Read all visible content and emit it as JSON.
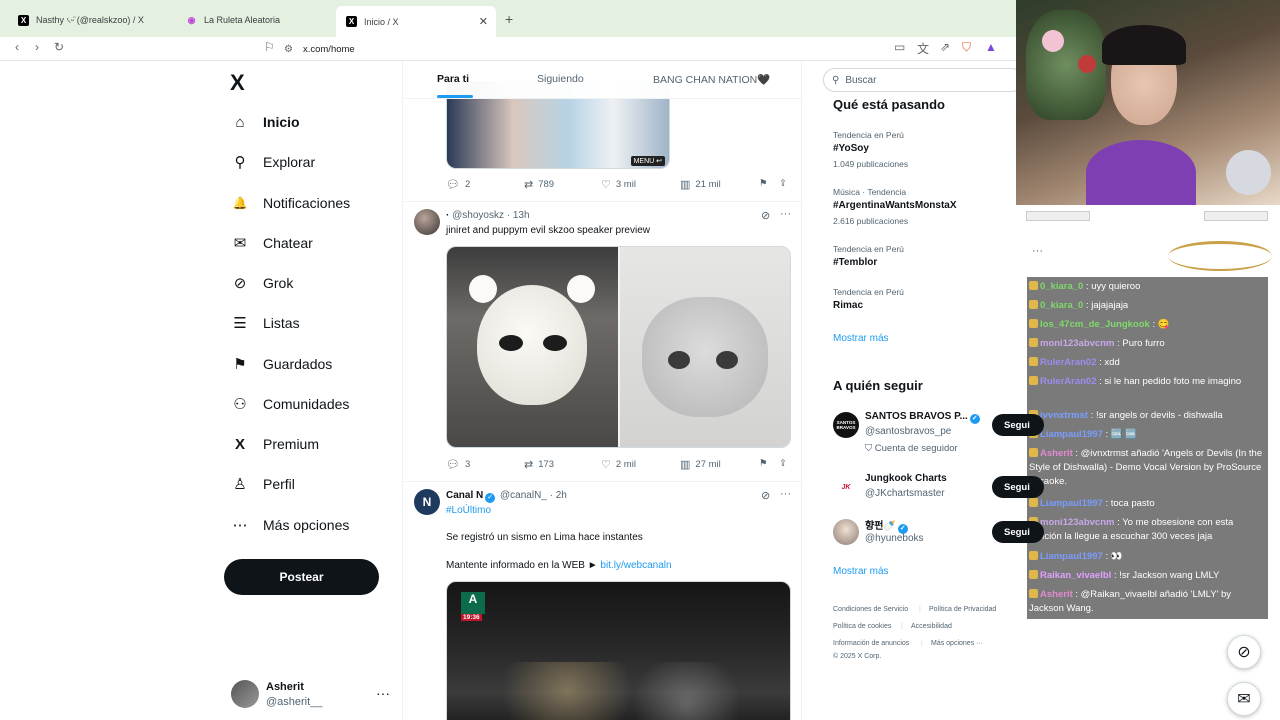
{
  "browser": {
    "tabs": [
      {
        "label": "Nasthy ৻ᵕ̈ (@realskzoo) / X",
        "favicon": "x-logo"
      },
      {
        "label": "La Ruleta Aleatoria",
        "favicon": "roulette"
      },
      {
        "label": "Inicio / X",
        "favicon": "x-logo"
      }
    ],
    "new_tab": "+",
    "url": "x.com/home"
  },
  "nav": {
    "logo": "X",
    "items": [
      {
        "label": "Inicio",
        "icon": "home-icon",
        "glyph": "⌂"
      },
      {
        "label": "Explorar",
        "icon": "search-icon",
        "glyph": "⚲"
      },
      {
        "label": "Notificaciones",
        "icon": "bell-icon",
        "glyph": "🔔"
      },
      {
        "label": "Chatear",
        "icon": "mail-icon",
        "glyph": "✉"
      },
      {
        "label": "Grok",
        "icon": "grok-icon",
        "glyph": "⊘"
      },
      {
        "label": "Listas",
        "icon": "list-icon",
        "glyph": "☰"
      },
      {
        "label": "Guardados",
        "icon": "bookmark-icon",
        "glyph": "⚑"
      },
      {
        "label": "Comunidades",
        "icon": "people-icon",
        "glyph": "⚇"
      },
      {
        "label": "Premium",
        "icon": "x-icon",
        "glyph": "X"
      },
      {
        "label": "Perfil",
        "icon": "person-icon",
        "glyph": "♙"
      },
      {
        "label": "Más opciones",
        "icon": "more-circle-icon",
        "glyph": "⋯"
      }
    ],
    "post_button": "Postear",
    "account": {
      "name": "Asherit",
      "handle": "@asherit__",
      "more": "···"
    }
  },
  "timeline": {
    "tabs": [
      "Para ti",
      "Siguiendo",
      "BANG CHAN NATION🖤"
    ],
    "post1": {
      "menu_badge": "MENU ↩",
      "replies": "2",
      "reposts": "789",
      "likes": "3 mil",
      "views": "21 mil"
    },
    "post2": {
      "author": "·",
      "handle": "@shoyoskz · 13h",
      "text": "jiniret and puppym evil skzoo speaker preview",
      "replies": "3",
      "reposts": "173",
      "likes": "2 mil",
      "views": "27 mil"
    },
    "post3": {
      "author": "Canal N",
      "handle": "@canalN_ · 2h",
      "hashtag": "#LoÚltimo",
      "text": "Se registró un sismo en Lima hace instantes",
      "link_prefix": "Mantente informado en la WEB ►",
      "link": "bit.ly/webcanaln",
      "video_time": "19:36"
    }
  },
  "sidebar": {
    "search_placeholder": "Buscar",
    "trends_title": "Qué está pasando",
    "trends": [
      {
        "context": "Tendencia en Perú",
        "tag": "#YoSoy",
        "count": "1.049 publicaciones"
      },
      {
        "context": "Música · Tendencia",
        "tag": "#ArgentinaWantsMonstaX",
        "count": "2.616 publicaciones"
      },
      {
        "context": "Tendencia en Perú",
        "tag": "#Temblor",
        "count": ""
      },
      {
        "context": "Tendencia en Perú",
        "tag": "Rimac",
        "count": ""
      }
    ],
    "trends_more": "Mostrar más",
    "who_title": "A quién seguir",
    "who": [
      {
        "name": "SANTOS BRAVOS P...",
        "handle": "@santosbravos_pe",
        "sub": "Cuenta de seguidor",
        "avatar_text": "SANTOS BRAVOS"
      },
      {
        "name": "Jungkook Charts",
        "handle": "@JKchartsmaster",
        "sub": "",
        "avatar_text": "JK"
      },
      {
        "name": "향펀🍼",
        "handle": "@hyuneboks",
        "sub": "",
        "avatar_text": ""
      }
    ],
    "follow_label": "Segui",
    "who_more": "Mostrar más",
    "footer": [
      "Condiciones de Servicio",
      "Política de Privacidad",
      "Política de cookies",
      "Accesibilidad",
      "Información de anuncios",
      "Más opciones ···",
      "© 2025 X Corp."
    ]
  },
  "stream": {
    "menu_dots": "···",
    "chat": [
      {
        "user": "0_kiara_0",
        "msg": ": uyy quieroo",
        "color": "#7fd96a"
      },
      {
        "user": "0_kiara_0",
        "msg": ": jajajajaja",
        "color": "#7fd96a"
      },
      {
        "user": "los_47cm_de_Jungkook",
        "msg": ": 😋",
        "color": "#7fd96a"
      },
      {
        "user": "moni123abvcnm",
        "msg": ": Puro furro",
        "color": "#c8a8e8"
      },
      {
        "user": "RulerAran02",
        "msg": ": xdd",
        "color": "#9d8cf0"
      },
      {
        "user": "RulerAran02",
        "msg": ": si le han pedido foto me imagino",
        "color": "#9d8cf0"
      },
      {
        "user": "ivvnxtrmst",
        "msg": ": !sr angels or devils - dishwalla",
        "color": "#7aa0ff"
      },
      {
        "user": "Liampaul1997",
        "msg": ": 🆒 🆒",
        "color": "#7a9cff"
      },
      {
        "user": "Asherit",
        "msg": ": @ivnxtrmst añadió 'Angels or Devils (In the Style of Dishwalla) - Demo Vocal Version by ProSource Karaoke.",
        "color": "#e28ad0"
      },
      {
        "user": "Liampaul1997",
        "msg": ": toca pasto",
        "color": "#7a9cff"
      },
      {
        "user": "moni123abvcnm",
        "msg": ": Yo me obsesione con esta canción la llegue a escuchar 300 veces jaja",
        "color": "#c8a8e8"
      },
      {
        "user": "Liampaul1997",
        "msg": ": 👀",
        "color": "#7a9cff"
      },
      {
        "user": "Raikan_vivaelbl",
        "msg": ": !sr Jackson wang LMLY",
        "color": "#e0a0ff"
      },
      {
        "user": "Asherit",
        "msg": ": @Raikan_vivaelbl añadió 'LMLY' by Jackson Wang.",
        "color": "#e28ad0"
      }
    ]
  },
  "colors": {
    "x_blue": "#1d9bf0",
    "text": "#0f1419",
    "muted": "#536471",
    "tab_bar": "#e4f0e0"
  }
}
